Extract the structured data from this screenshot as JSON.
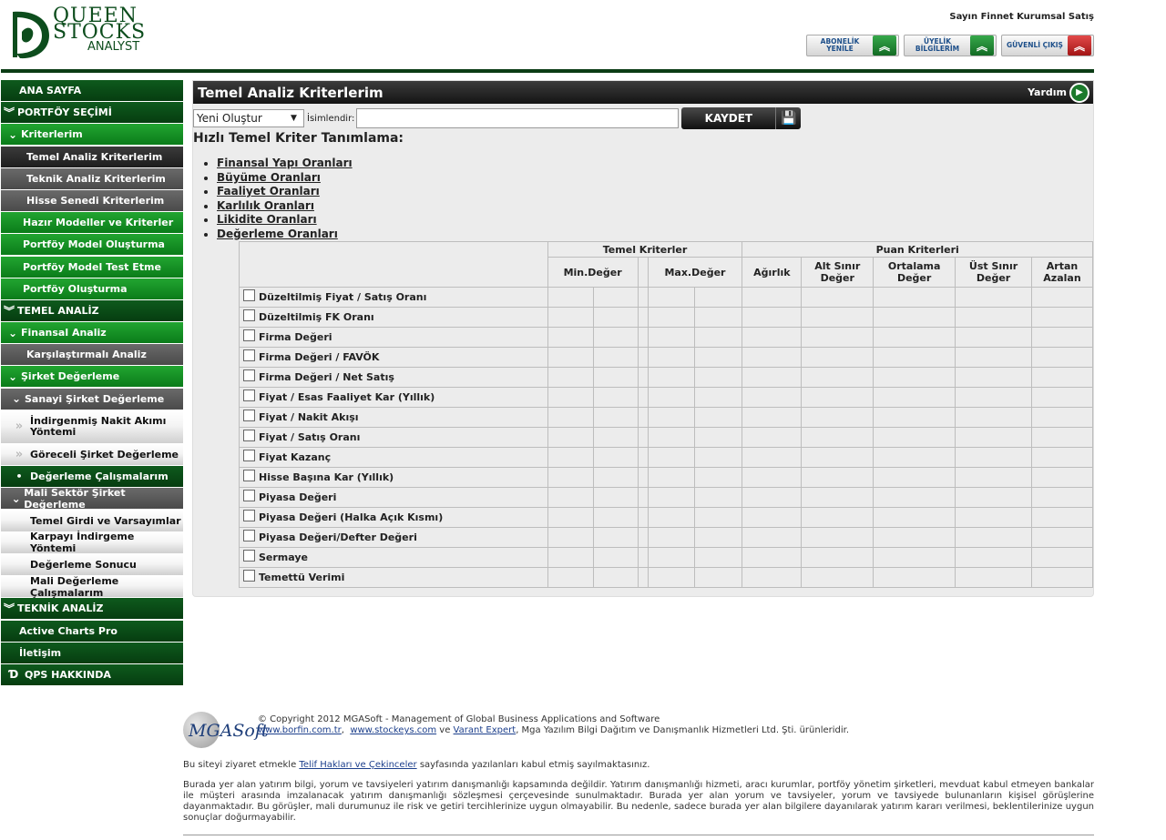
{
  "logo": {
    "line1": "QUEEN",
    "line2": "STOCKS",
    "line3": "ANALYST"
  },
  "header": {
    "user_name": "Sayın Finnet Kurumsal Satış",
    "buttons": [
      {
        "label": "ABONELİK YENİLE",
        "color": "#1a8a30"
      },
      {
        "label": "ÜYELİK BİLGİLERİM",
        "color": "#1a8a30"
      },
      {
        "label": "GÜVENLİ ÇIKIŞ",
        "color": "#c42020"
      }
    ]
  },
  "sidebar": {
    "items": [
      {
        "label": "ANA SAYFA"
      },
      {
        "label": "PORTFÖY SEÇİMİ"
      },
      {
        "label": "Kriterlerim"
      },
      {
        "label": "Temel Analiz Kriterlerim"
      },
      {
        "label": "Teknik Analiz Kriterlerim"
      },
      {
        "label": "Hisse Senedi Kriterlerim"
      },
      {
        "label": "Hazır Modeller ve Kriterler"
      },
      {
        "label": "Portföy Model Oluşturma"
      },
      {
        "label": "Portföy Model Test Etme"
      },
      {
        "label": "Portföy Oluşturma"
      },
      {
        "label": "TEMEL ANALİZ"
      },
      {
        "label": "Finansal Analiz"
      },
      {
        "label": "Karşılaştırmalı Analiz"
      },
      {
        "label": "Şirket Değerleme"
      },
      {
        "label": "Sanayi Şirket Değerleme"
      },
      {
        "label": "İndirgenmiş Nakit Akımı Yöntemi"
      },
      {
        "label": "Göreceli Şirket Değerleme"
      },
      {
        "label": "Değerleme Çalışmalarım"
      },
      {
        "label": "Mali Sektör Şirket Değerleme"
      },
      {
        "label": "Temel Girdi ve Varsayımlar"
      },
      {
        "label": "Karpayı İndirgeme Yöntemi"
      },
      {
        "label": "Değerleme Sonucu"
      },
      {
        "label": "Mali Değerleme Çalışmalarım"
      },
      {
        "label": "TEKNİK ANALİZ"
      },
      {
        "label": "Active Charts Pro"
      },
      {
        "label": "İletişim"
      },
      {
        "label": "QPS HAKKINDA"
      }
    ]
  },
  "main": {
    "title": "Temel Analiz Kriterlerim",
    "help_label": "Yardım",
    "select_value": "Yeni Oluştur",
    "name_label": "İsimlendir:",
    "name_value": "",
    "save_label": "KAYDET",
    "subtitle": "Hızlı Temel Kriter Tanımlama:",
    "links": [
      "Finansal Yapı Oranları",
      "Büyüme Oranları",
      "Faaliyet Oranları",
      "Karlılık Oranları",
      "Likidite Oranları",
      "Değerleme Oranları"
    ],
    "table": {
      "group1": "Temel Kriterler",
      "group2": "Puan Kriterleri",
      "min": "Min.Değer",
      "max": "Max.Değer",
      "weight": "Ağırlık",
      "lower": "Alt Sınır Değer",
      "avg": "Ortalama Değer",
      "upper": "Üst Sınır Değer",
      "order": "Artan Azalan",
      "rows": [
        "Düzeltilmiş Fiyat / Satış Oranı",
        "Düzeltilmiş FK Oranı",
        "Firma Değeri",
        "Firma Değeri / FAVÖK",
        "Firma Değeri / Net Satış",
        "Fiyat / Esas Faaliyet Kar (Yıllık)",
        "Fiyat / Nakit Akışı",
        "Fiyat / Satış Oranı",
        "Fiyat Kazanç",
        "Hisse Başına Kar (Yıllık)",
        "Piyasa Değeri",
        "Piyasa Değeri (Halka Açık Kısmı)",
        "Piyasa Değeri/Defter Değeri",
        "Sermaye",
        "Temettü Verimi"
      ]
    }
  },
  "footer": {
    "logo_text": "MGASoft",
    "copyright": "© Copyright 2012 MGASoft - Management of Global Business Applications and Software",
    "link1": "www.borfin.com.tr",
    "link2": "www.stockeys.com",
    "link3": "Varant Expert",
    "owner_text": ", Mga Yazılım Bilgi Dağıtım ve Danışmanlık Hizmetleri Ltd. Şti. ürünleridir.",
    "notice_pre": "Bu siteyi ziyaret etmekle",
    "notice_link": "Telif Hakları ve Çekinceler",
    "notice_post": "sayfasında yazılanları kabul etmiş sayılmaktasınız.",
    "disclaimer": "Burada yer alan yatırım bilgi, yorum ve tavsiyeleri yatırım danışmanlığı kapsamında değildir. Yatırım danışmanlığı hizmeti, aracı kurumlar, portföy yönetim şirketleri, mevduat kabul etmeyen bankalar ile müşteri arasında imzalanacak yatırım danışmanlığı sözleşmesi çerçevesinde sunulmaktadır. Burada yer alan yorum ve tavsiyeler, yorum ve tavsiyede bulunanların kişisel görüşlerine dayanmaktadır. Bu görüşler, mali durumunuz ile risk ve getiri tercihlerinize uygun olmayabilir. Bu nedenle, sadece burada yer alan bilgilere dayanılarak yatırım kararı verilmesi, beklentilerinize uygun sonuçlar doğurmayabilir."
  }
}
